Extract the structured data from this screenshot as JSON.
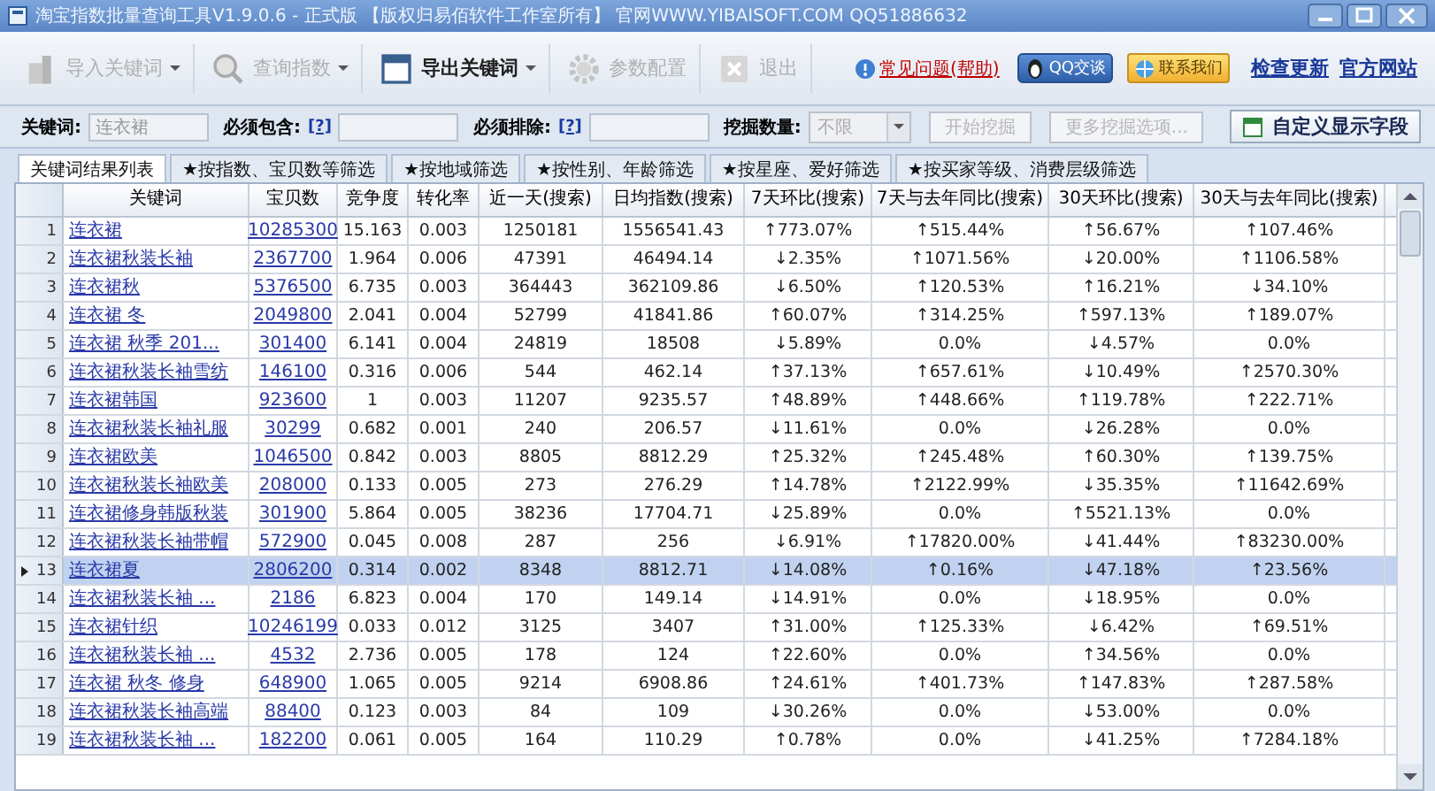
{
  "window": {
    "title": "淘宝指数批量查询工具V1.9.0.6 - 正式版 【版权归易佰软件工作室所有】 官网WWW.YIBAISOFT.COM QQ51886632"
  },
  "toolbar": [
    {
      "label": "导入关键词",
      "disabled": true,
      "dropdown": true,
      "kind": "import"
    },
    {
      "label": "查询指数",
      "disabled": true,
      "dropdown": true,
      "kind": "search"
    },
    {
      "label": "导出关键词",
      "disabled": false,
      "dropdown": true,
      "kind": "export"
    },
    {
      "label": "参数配置",
      "disabled": true,
      "dropdown": false,
      "kind": "settings"
    },
    {
      "label": "退出",
      "disabled": true,
      "dropdown": false,
      "kind": "exit"
    }
  ],
  "links": [
    {
      "label": "常见问题(帮助)",
      "kind": "help"
    },
    {
      "label": "QQ交谈",
      "kind": "qq"
    },
    {
      "label": "联系我们",
      "kind": "contact"
    },
    {
      "label": "检查更新",
      "kind": "link"
    },
    {
      "label": "官方网站",
      "kind": "link"
    }
  ],
  "filters": {
    "keyword": {
      "label": "关键词:",
      "value": "连衣裙"
    },
    "include": {
      "label": "必须包含:",
      "help": "[?]"
    },
    "exclude": {
      "label": "必须排除:",
      "help": "[?]"
    },
    "count": {
      "label": "挖掘数量:",
      "value": "不限",
      "disabled": true
    },
    "buttons": [
      {
        "label": "开始挖掘",
        "disabled": true
      },
      {
        "label": "更多挖掘选项...",
        "disabled": true
      }
    ],
    "custom_button": "自定义显示字段"
  },
  "tabs": [
    {
      "label": "关键词结果列表",
      "selected": true
    },
    {
      "label": "★按指数、宝贝数等筛选",
      "selected": false
    },
    {
      "label": "★按地域筛选",
      "selected": false
    },
    {
      "label": "★按性别、年龄筛选",
      "selected": false
    },
    {
      "label": "★按星座、爱好筛选",
      "selected": false
    },
    {
      "label": "★按买家等级、消费层级筛选",
      "selected": false
    }
  ],
  "table": {
    "columns": [
      "关键词",
      "宝贝数",
      "竞争度",
      "转化率",
      "近一天(搜索)",
      "日均指数(搜索)",
      "7天环比(搜索)",
      "7天与去年同比(搜索)",
      "30天环比(搜索)",
      "30天与去年同比(搜索)"
    ],
    "rows": [
      {
        "number": "1",
        "selected": false,
        "cells": [
          "连衣裙",
          "10285300",
          "15.163",
          "0.003",
          "1250181",
          "1556541.43",
          "↑773.07%",
          "↑515.44%",
          "↑56.67%",
          "↑107.46%"
        ]
      },
      {
        "number": "2",
        "selected": false,
        "cells": [
          "连衣裙秋装长袖",
          "2367700",
          "1.964",
          "0.006",
          "47391",
          "46494.14",
          "↓2.35%",
          "↑1071.56%",
          "↓20.00%",
          "↑1106.58%"
        ]
      },
      {
        "number": "3",
        "selected": false,
        "cells": [
          "连衣裙秋",
          "5376500",
          "6.735",
          "0.003",
          "364443",
          "362109.86",
          "↓6.50%",
          "↑120.53%",
          "↑16.21%",
          "↓34.10%"
        ]
      },
      {
        "number": "4",
        "selected": false,
        "cells": [
          "连衣裙 冬",
          "2049800",
          "2.041",
          "0.004",
          "52799",
          "41841.86",
          "↑60.07%",
          "↑314.25%",
          "↑597.13%",
          "↑189.07%"
        ]
      },
      {
        "number": "5",
        "selected": false,
        "cells": [
          "连衣裙 秋季 201...",
          "301400",
          "6.141",
          "0.004",
          "24819",
          "18508",
          "↓5.89%",
          "0.0%",
          "↓4.57%",
          "0.0%"
        ]
      },
      {
        "number": "6",
        "selected": false,
        "cells": [
          "连衣裙秋装长袖雪纺",
          "146100",
          "0.316",
          "0.006",
          "544",
          "462.14",
          "↑37.13%",
          "↑657.61%",
          "↓10.49%",
          "↑2570.30%"
        ]
      },
      {
        "number": "7",
        "selected": false,
        "cells": [
          "连衣裙韩国",
          "923600",
          "1",
          "0.003",
          "11207",
          "9235.57",
          "↑48.89%",
          "↑448.66%",
          "↑119.78%",
          "↑222.71%"
        ]
      },
      {
        "number": "8",
        "selected": false,
        "cells": [
          "连衣裙秋装长袖礼服",
          "30299",
          "0.682",
          "0.001",
          "240",
          "206.57",
          "↓11.61%",
          "0.0%",
          "↓26.28%",
          "0.0%"
        ]
      },
      {
        "number": "9",
        "selected": false,
        "cells": [
          "连衣裙欧美",
          "1046500",
          "0.842",
          "0.003",
          "8805",
          "8812.29",
          "↑25.32%",
          "↑245.48%",
          "↑60.30%",
          "↑139.75%"
        ]
      },
      {
        "number": "10",
        "selected": false,
        "cells": [
          "连衣裙秋装长袖欧美",
          "208000",
          "0.133",
          "0.005",
          "273",
          "276.29",
          "↑14.78%",
          "↑2122.99%",
          "↓35.35%",
          "↑11642.69%"
        ]
      },
      {
        "number": "11",
        "selected": false,
        "cells": [
          "连衣裙修身韩版秋装",
          "301900",
          "5.864",
          "0.005",
          "38236",
          "17704.71",
          "↓25.89%",
          "0.0%",
          "↑5521.13%",
          "0.0%"
        ]
      },
      {
        "number": "12",
        "selected": false,
        "cells": [
          "连衣裙秋装长袖带帽",
          "572900",
          "0.045",
          "0.008",
          "287",
          "256",
          "↓6.91%",
          "↑17820.00%",
          "↓41.44%",
          "↑83230.00%"
        ]
      },
      {
        "number": "13",
        "selected": true,
        "cells": [
          "连衣裙夏",
          "2806200",
          "0.314",
          "0.002",
          "8348",
          "8812.71",
          "↓14.08%",
          "↑0.16%",
          "↓47.18%",
          "↑23.56%"
        ]
      },
      {
        "number": "14",
        "selected": false,
        "cells": [
          "连衣裙秋装长袖 ...",
          "2186",
          "6.823",
          "0.004",
          "170",
          "149.14",
          "↓14.91%",
          "0.0%",
          "↓18.95%",
          "0.0%"
        ]
      },
      {
        "number": "15",
        "selected": false,
        "cells": [
          "连衣裙针织",
          "10246199",
          "0.033",
          "0.012",
          "3125",
          "3407",
          "↑31.00%",
          "↑125.33%",
          "↓6.42%",
          "↑69.51%"
        ]
      },
      {
        "number": "16",
        "selected": false,
        "cells": [
          "连衣裙秋装长袖 ...",
          "4532",
          "2.736",
          "0.005",
          "178",
          "124",
          "↑22.60%",
          "0.0%",
          "↑34.56%",
          "0.0%"
        ]
      },
      {
        "number": "17",
        "selected": false,
        "cells": [
          "连衣裙 秋冬 修身",
          "648900",
          "1.065",
          "0.005",
          "9214",
          "6908.86",
          "↑24.61%",
          "↑401.73%",
          "↑147.83%",
          "↑287.58%"
        ]
      },
      {
        "number": "18",
        "selected": false,
        "cells": [
          "连衣裙秋装长袖高端",
          "88400",
          "0.123",
          "0.003",
          "84",
          "109",
          "↓30.26%",
          "0.0%",
          "↓53.00%",
          "0.0%"
        ]
      },
      {
        "number": "19",
        "selected": false,
        "cells": [
          "连衣裙秋装长袖 ...",
          "182200",
          "0.061",
          "0.005",
          "164",
          "110.29",
          "↑0.78%",
          "0.0%",
          "↓41.25%",
          "↑7284.18%"
        ]
      }
    ]
  }
}
